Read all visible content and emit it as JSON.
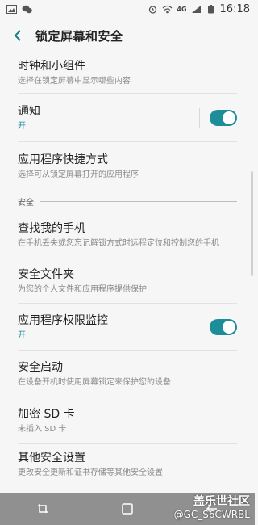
{
  "status_bar": {
    "network": "4G",
    "time": "16:18"
  },
  "app_bar": {
    "title": "锁定屏幕和安全"
  },
  "items": [
    {
      "title": "时钟和小组件",
      "subtitle": "选择在锁定屏幕中显示哪些内容"
    },
    {
      "title": "通知",
      "subtitle": "开",
      "toggle": true
    },
    {
      "title": "应用程序快捷方式",
      "subtitle": "选择可从锁定屏幕打开的应用程序"
    }
  ],
  "section": {
    "label": "安全"
  },
  "security_items": [
    {
      "title": "查找我的手机",
      "subtitle": "在手机丢失或您忘记解锁方式时远程定位和控制您的手机"
    },
    {
      "title": "安全文件夹",
      "subtitle": "为您的个人文件和应用程序提供保护"
    },
    {
      "title": "应用程序权限监控",
      "subtitle": "开",
      "toggle": true
    },
    {
      "title": "安全启动",
      "subtitle": "在设备开机时使用屏幕锁定来保护您的设备"
    },
    {
      "title": "加密 SD 卡",
      "subtitle": "未插入 SD 卡"
    },
    {
      "title": "其他安全设置",
      "subtitle": "更改安全更新和证书存储等其他安全设置"
    }
  ],
  "watermark": {
    "line1": "盖乐世社区",
    "line2": "@GC_S6CWRBL"
  },
  "colors": {
    "accent": "#1c8d99",
    "background": "#f6f6f6"
  }
}
